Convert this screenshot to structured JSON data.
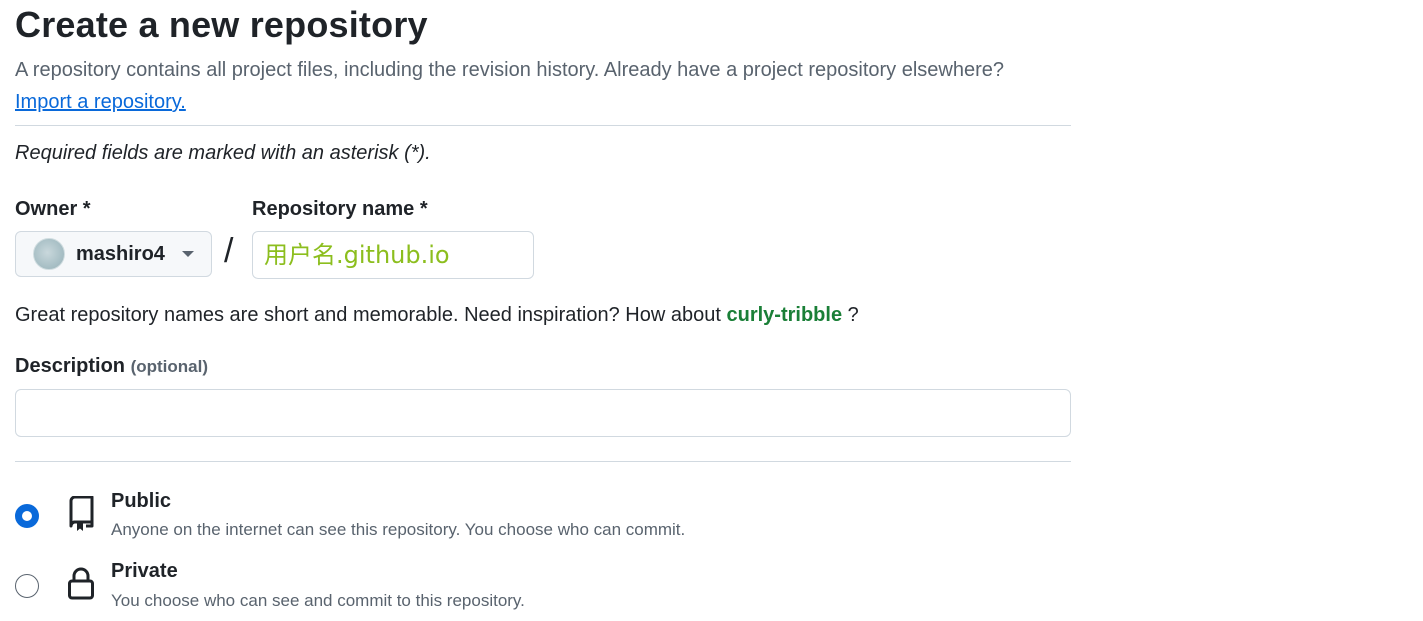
{
  "header": {
    "title": "Create a new repository",
    "subtitle": "A repository contains all project files, including the revision history. Already have a project repository elsewhere?",
    "import_link": "Import a repository."
  },
  "form": {
    "required_note": "Required fields are marked with an asterisk (*).",
    "owner": {
      "label": "Owner *",
      "value": "mashiro4",
      "avatar_icon": "avatar",
      "dropdown_icon": "caret-down-icon"
    },
    "separator": "/",
    "repository_name": {
      "label": "Repository name *",
      "value": "用户名.github.io"
    },
    "hint": {
      "text": "Great repository names are short and memorable. Need inspiration? How about",
      "suggestion": "curly-tribble",
      "suffix": " ?"
    },
    "description": {
      "label": "Description",
      "optional": "(optional)",
      "value": ""
    },
    "visibility": [
      {
        "key": "public",
        "title": "Public",
        "description": "Anyone on the internet can see this repository. You choose who can commit.",
        "icon": "repo-icon",
        "selected": true
      },
      {
        "key": "private",
        "title": "Private",
        "description": "You choose who can see and commit to this repository.",
        "icon": "lock-icon",
        "selected": false
      }
    ]
  },
  "colors": {
    "accent": "#0969da",
    "suggestion": "#1a7f37",
    "muted": "#59636e",
    "border": "#d1d9e0",
    "repo_name_text": "#8cbe1e"
  }
}
